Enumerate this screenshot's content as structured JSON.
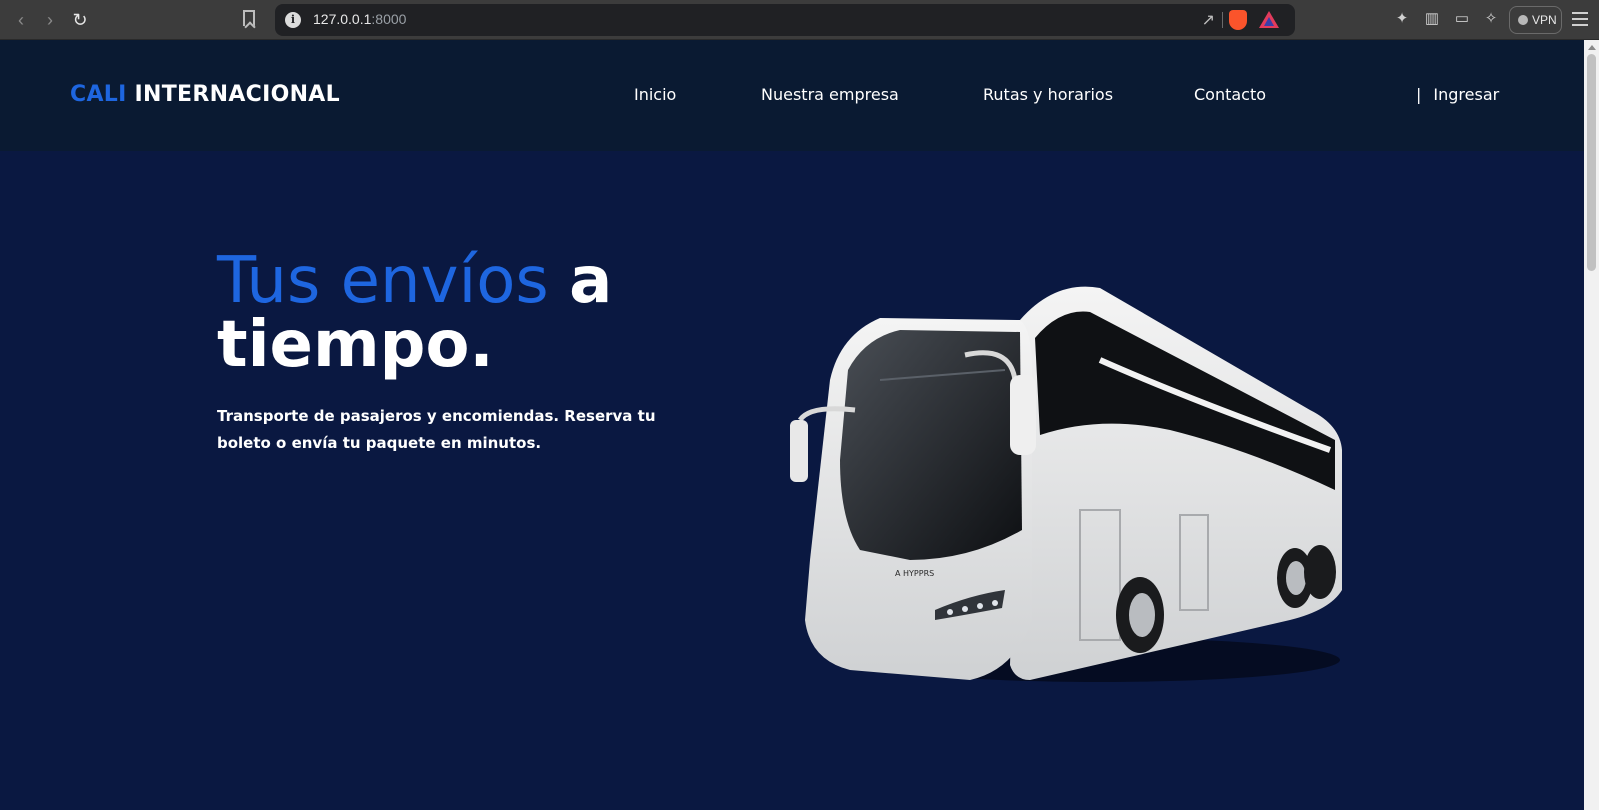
{
  "browser": {
    "url_host": "127.0.0.1",
    "url_port": ":8000",
    "vpn_label": "VPN"
  },
  "site": {
    "logo_accent": "CALI",
    "logo_rest": "INTERNACIONAL",
    "nav": [
      {
        "label": "Inicio"
      },
      {
        "label": "Nuestra empresa"
      },
      {
        "label": "Rutas y horarios"
      },
      {
        "label": "Contacto"
      }
    ],
    "login_separator": "|",
    "login_label": "Ingresar"
  },
  "hero": {
    "title_blue": "Tus envíos",
    "title_white_1": "a",
    "title_white_2": "tiempo.",
    "subtitle": "Transporte de pasajeros y encomiendas. Reserva tu boleto o envía tu paquete en minutos.",
    "bus_brand": "A HYPPRS"
  },
  "colors": {
    "header_bg": "#0a1a32",
    "hero_bg": "#0a1841",
    "accent": "#1e66e0"
  }
}
